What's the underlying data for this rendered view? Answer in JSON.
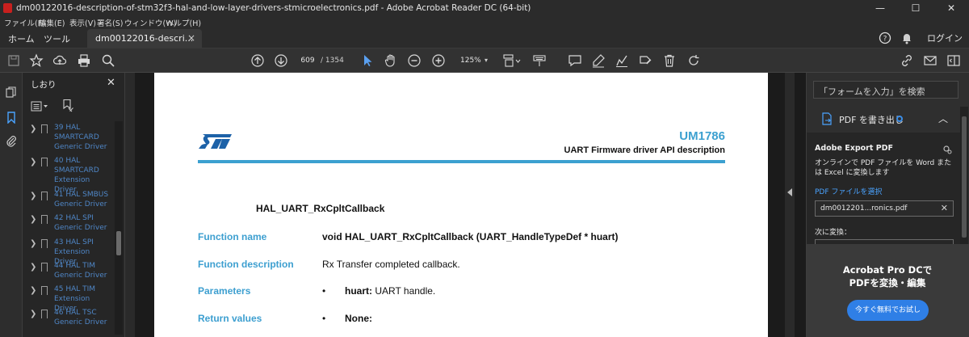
{
  "window": {
    "title": "dm00122016-description-of-stm32f3-hal-and-low-layer-drivers-stmicroelectronics.pdf - Adobe Acrobat Reader DC (64-bit)",
    "minimize": "—",
    "maximize": "☐",
    "close": "✕"
  },
  "menu": [
    "ファイル(F)",
    "編集(E)",
    "表示(V)",
    "署名(S)",
    "ウィンドウ(W)",
    "ヘルプ(H)"
  ],
  "tabs": {
    "home": "ホーム",
    "tools": "ツール",
    "document": "dm00122016-descri...",
    "document_close": "×",
    "login": "ログイン"
  },
  "toolbar": {
    "page_current": "609",
    "page_total": "/ 1354",
    "zoom": "125%",
    "zoom_caret": "▾"
  },
  "bookmarks": {
    "title": "しおり",
    "close": "✕",
    "items": [
      {
        "label": "39 HAL SMARTCARD Generic Driver"
      },
      {
        "label": "40 HAL SMARTCARD Extension Driver"
      },
      {
        "label": "41 HAL SMBUS Generic Driver"
      },
      {
        "label": "42 HAL SPI Generic Driver"
      },
      {
        "label": "43 HAL SPI Extension Driver"
      },
      {
        "label": "44 HAL TIM Generic Driver"
      },
      {
        "label": "45 HAL TIM Extension Driver"
      },
      {
        "label": "46 HAL TSC Generic Driver"
      }
    ]
  },
  "document": {
    "doc_id": "UM1786",
    "subtitle": "UART Firmware driver API description",
    "function_title": "HAL_UART_RxCpltCallback",
    "rows": {
      "name_label": "Function name",
      "name_value": "void HAL_UART_RxCpltCallback (UART_HandleTypeDef * huart)",
      "desc_label": "Function description",
      "desc_value": "Rx Transfer completed callback.",
      "params_label": "Parameters",
      "params_bullet": "•",
      "params_name": "huart:",
      "params_text": " UART handle.",
      "return_label": "Return values",
      "return_bullet": "•",
      "return_value": "None:"
    }
  },
  "right_pane": {
    "search_placeholder": "「フォームを入力」を検索",
    "export_title": "PDF を書き出し",
    "up_chevron": "︿",
    "export_service": "Adobe Export PDF",
    "export_desc": "オンラインで PDF ファイルを Word または Excel に変換します",
    "select_link": "PDF ファイルを選択",
    "file_name": "dm0012201...ronics.pdf",
    "file_clear": "✕",
    "convert_to": "次に変換：",
    "pro_line1": "Acrobat Pro DCで",
    "pro_line2": "PDFを変換・編集",
    "pro_button": "今すぐ無料でお試し"
  },
  "colors": {
    "accent_blue": "#3ca0d0",
    "link_blue": "#4aa3ff",
    "button_blue": "#2f7fe6",
    "bookmark_blue": "#4f86c6"
  }
}
